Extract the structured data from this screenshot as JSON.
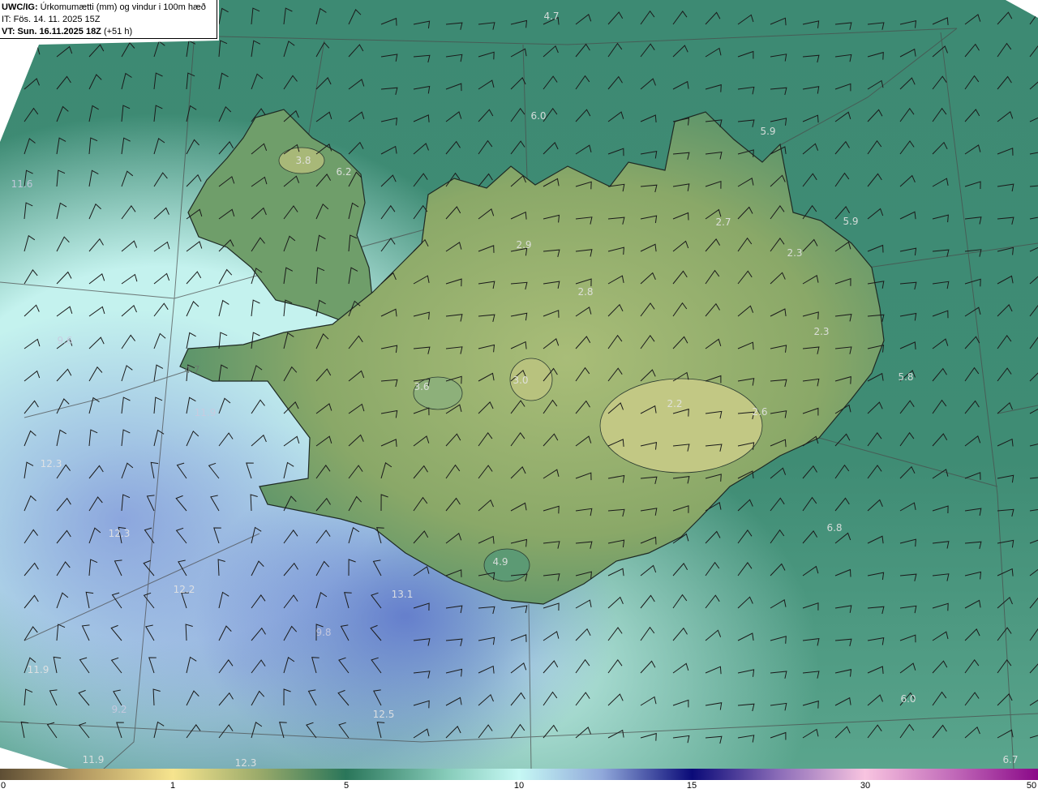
{
  "header": {
    "model": "UWC/IG:",
    "title": "Úrkomumætti (mm) og vindur i 100m hæð",
    "issue_time": "IT: Fös. 14. 11. 2025 15Z",
    "valid_label": "VT: Sun. 16.11.2025 18Z",
    "lead": "(+51 h)"
  },
  "map": {
    "labels": [
      "4.7",
      "6.0",
      "5.9",
      "3.8",
      "6.2",
      "11.6",
      "2.7",
      "5.9",
      "2.9",
      "2.3",
      "2.8",
      "2.3",
      "9.6",
      "4.7",
      "5.8",
      "3.6",
      "3.0",
      "2.2",
      "2.6",
      "11.9",
      "12.3",
      "12.3",
      "6.8",
      "4.9",
      "12.2",
      "13.1",
      "9.8",
      "11.9",
      "6.0",
      "9.2",
      "12.5",
      "11.9",
      "12.3",
      "6.7"
    ]
  },
  "colorbar": {
    "ticks": [
      "0",
      "1",
      "5",
      "10",
      "15",
      "30",
      "50"
    ],
    "colors": [
      "#5e4e34",
      "#f6e48e",
      "#2a765a",
      "#c6f8f4",
      "#0a0a78",
      "#f8c4e0",
      "#8a0888"
    ]
  }
}
